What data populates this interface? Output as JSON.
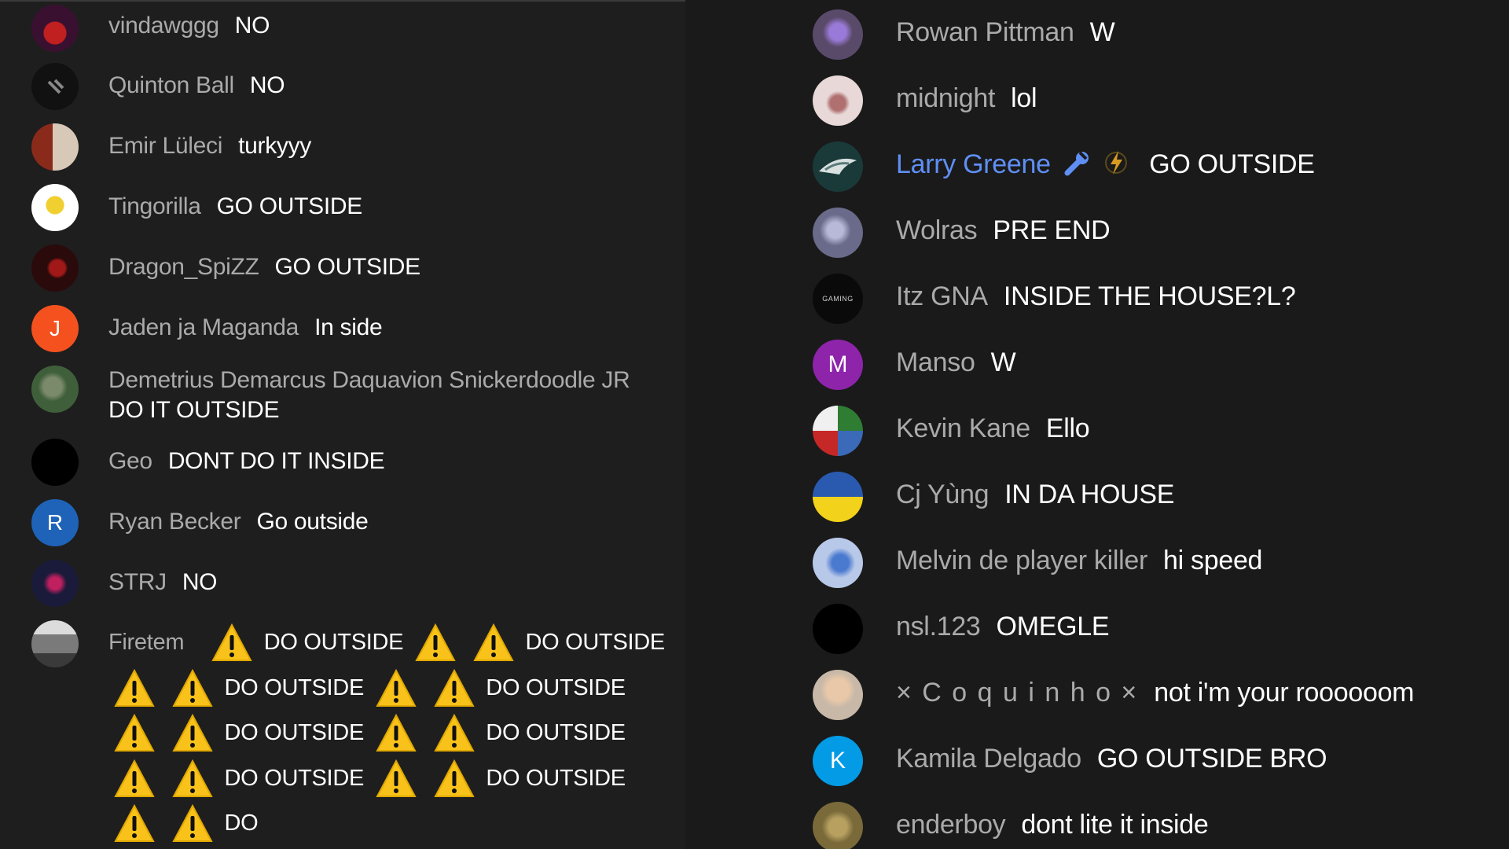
{
  "left_chat": [
    {
      "author": "vindawggg",
      "text": "NO",
      "avatar_color": "#3a1030"
    },
    {
      "author": "Quinton Ball",
      "text": "NO",
      "avatar_color": "#111111"
    },
    {
      "author": "Emir Lüleci",
      "text": "turkyyy",
      "avatar_color": "#6b5a4c"
    },
    {
      "author": "Tingorilla",
      "text": "GO OUTSIDE",
      "avatar_color": "#e8d890"
    },
    {
      "author": "Dragon_SpiZZ",
      "text": "GO OUTSIDE",
      "avatar_color": "#2a0a0a"
    },
    {
      "author": "Jaden ja Maganda",
      "text": "In side",
      "avatar_color": "#f4511e",
      "avatar_letter": "J"
    },
    {
      "author": "Demetrius Demarcus Daquavion Snickerdoodle JR",
      "text": "DO IT OUTSIDE",
      "avatar_color": "#3f5f3a"
    },
    {
      "author": "Geo",
      "text": "DONT DO IT INSIDE",
      "avatar_color": "#000000"
    },
    {
      "author": "Ryan Becker",
      "text": "Go outside",
      "avatar_color": "#1e63b8",
      "avatar_letter": "R"
    },
    {
      "author": "STRJ",
      "text": "NO",
      "avatar_color": "#1a1a3a"
    },
    {
      "author": "Firetem",
      "text_segment": "DO OUTSIDE",
      "text_segment_2": "DO",
      "text_segment_3": "OUTSIDE",
      "avatar_color": "#8a8a8a"
    }
  ],
  "right_chat": [
    {
      "author": "Rowan Pittman",
      "text": "W",
      "avatar_color": "#5a4a6a"
    },
    {
      "author": "midnight",
      "text": "lol",
      "avatar_color": "#d8c8c8"
    },
    {
      "author": "Larry Greene",
      "text": "GO OUTSIDE",
      "avatar_color": "#1a3a3a",
      "role": "moderator"
    },
    {
      "author": "Wolras",
      "text": "PRE END",
      "avatar_color": "#6a6a8a"
    },
    {
      "author": "Itz GNA",
      "text": "INSIDE THE HOUSE?L?",
      "avatar_color": "#0a0a0a",
      "avatar_caption": "GAMING"
    },
    {
      "author": "Manso",
      "text": "W",
      "avatar_color": "#8e24aa",
      "avatar_letter": "M"
    },
    {
      "author": "Kevin Kane",
      "text": "Ello",
      "avatar_color": "#3a6ab8"
    },
    {
      "author": "Cj Yùng",
      "text": "IN DA HOUSE",
      "avatar_color": "#2a5ab0"
    },
    {
      "author": "Melvin de player killer",
      "text": "hi speed",
      "avatar_color": "#b8c8e8"
    },
    {
      "author": "nsl.123",
      "text": "OMEGLE",
      "avatar_color": "#000000"
    },
    {
      "author": "× C o q u i n h o ×",
      "text": "not i'm your roooooom",
      "avatar_color": "#c8b8a8"
    },
    {
      "author": "Kamila Delgado",
      "text": "GO OUTSIDE BRO",
      "avatar_color": "#039be5",
      "avatar_letter": "K"
    },
    {
      "author": "enderboy",
      "text": "dont lite it inside",
      "avatar_color": "#7a6a3a"
    }
  ],
  "colors": {
    "moderator": "#5f8ff5",
    "author": "#aaaaaa",
    "text": "#ffffff",
    "warning": "#f9c21a"
  },
  "icons": {
    "warning": "warning-sign-icon",
    "moderator": "wrench-icon",
    "badge": "lightning-icon"
  }
}
